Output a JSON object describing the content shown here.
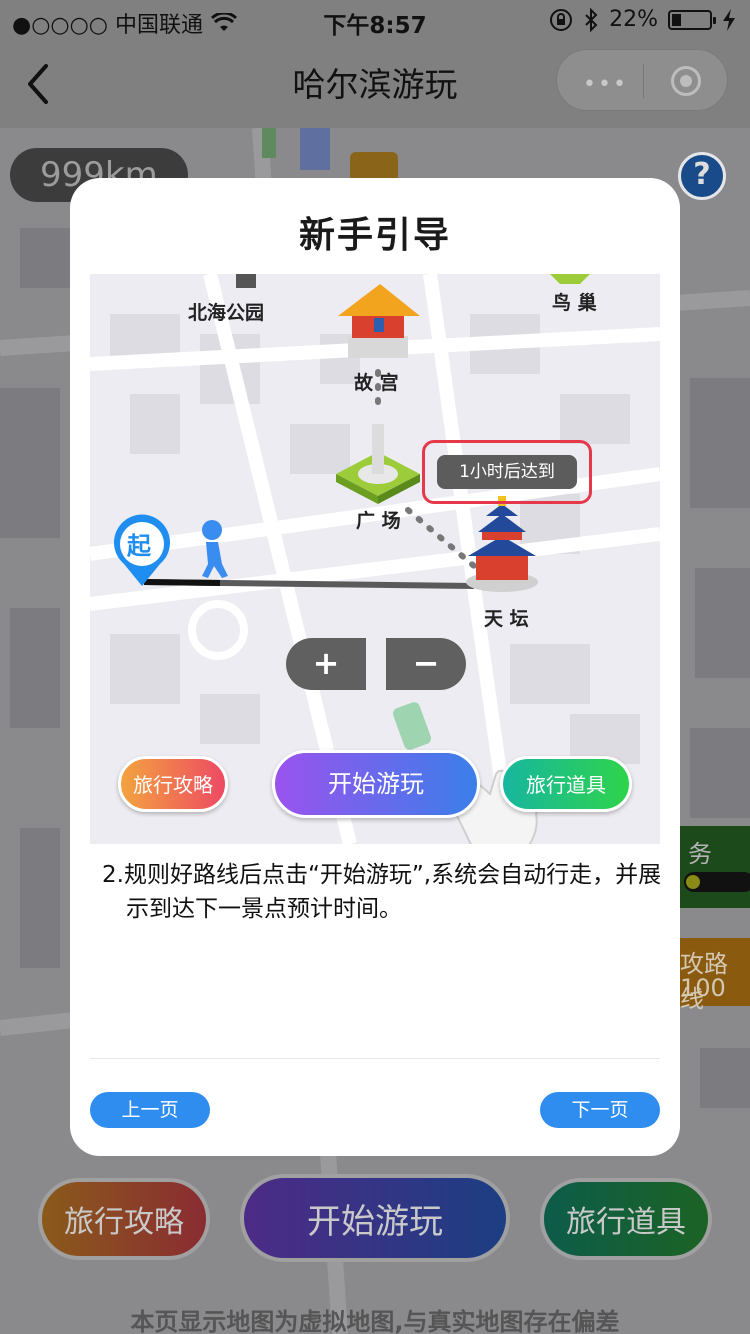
{
  "status_bar": {
    "carrier": "●○○○○ 中国联通",
    "time": "下午8:57",
    "battery": "22%",
    "battery_level": 0.22,
    "icons": [
      "wifi-icon",
      "lock-rotation-icon",
      "bluetooth-icon",
      "charging-icon"
    ]
  },
  "nav": {
    "title": "哈尔滨游玩",
    "capsule_dots": "•••"
  },
  "background": {
    "distance": "999km",
    "help_label": "?",
    "side_task": "务",
    "side_route_line1": "攻路线",
    "side_route_line2": "100",
    "buttons": {
      "guide": "旅行攻略",
      "start": "开始游玩",
      "tools": "旅行道具"
    },
    "disclaimer": "本页显示地图为虚拟地图,与真实地图存在偏差"
  },
  "modal": {
    "title": "新手引导",
    "preview": {
      "labels": {
        "beihai": "北海公园",
        "gugong": "故 宫",
        "niaochao": "鸟 巢",
        "guangchang": "广 场",
        "tiantan": "天 坛",
        "start_pin": "起"
      },
      "eta": "1小时后达到",
      "zoom_in": "+",
      "zoom_out": "−",
      "buttons": {
        "guide": "旅行攻略",
        "start": "开始游玩",
        "tools": "旅行道具"
      }
    },
    "description": "2.规则好路线后点击“开始游玩”,系统会自动行走，并展示到达下一景点预计时间。",
    "prev": "上一页",
    "next": "下一页"
  },
  "colors": {
    "accent_blue": "#2f8df0",
    "eta_border": "#e5394b",
    "start_gradient": [
      "#9a53ee",
      "#3a7fea"
    ],
    "guide_gradient": [
      "#f3a33f",
      "#ee4a63"
    ],
    "tools_gradient": [
      "#17b6a0",
      "#2fd44a"
    ]
  }
}
